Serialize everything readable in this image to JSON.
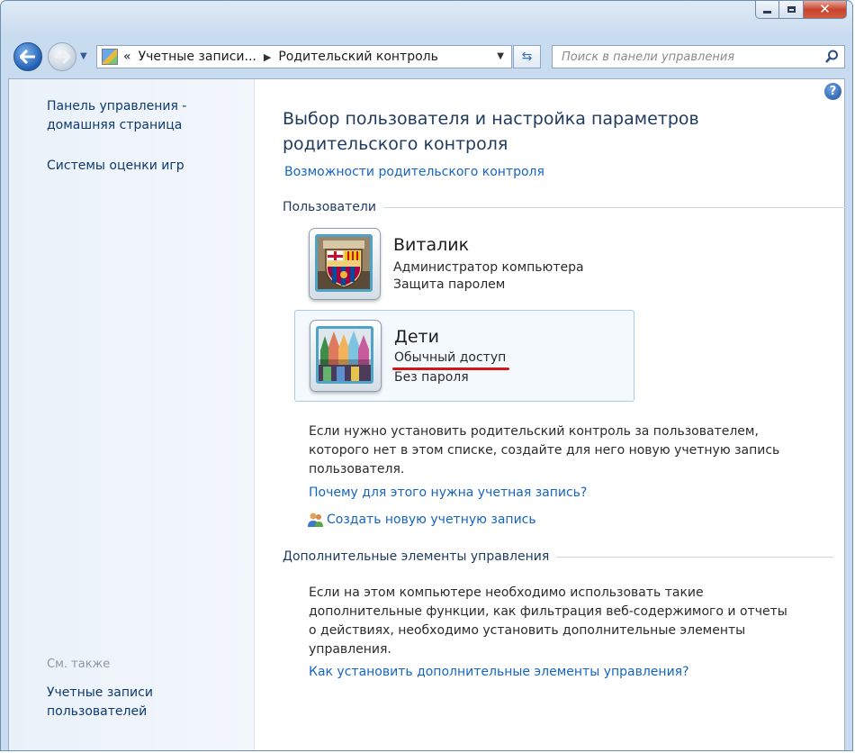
{
  "window": {
    "caption": {
      "minimize": "minimize",
      "maximize": "maximize",
      "close": "✕"
    }
  },
  "nav": {
    "breadcrumb": [
      "«",
      "Учетные записи...",
      "Родительский контроль"
    ],
    "search_placeholder": "Поиск в панели управления"
  },
  "sidebar": {
    "home_link": [
      "Панель управления -",
      "домашняя страница"
    ],
    "game_ratings": "Системы оценки игр",
    "see_also": "См. также",
    "user_accounts": [
      "Учетные записи",
      "пользователей"
    ]
  },
  "main": {
    "help": "?",
    "title": [
      "Выбор пользователя и настройка параметров",
      "родительского контроля"
    ],
    "features_link": "Возможности родительского контроля",
    "users_heading": "Пользователи",
    "users": [
      {
        "name": "Виталик",
        "type": "Администратор компьютера",
        "password": "Защита паролем"
      },
      {
        "name": "Дети",
        "type": "Обычный доступ",
        "password": "Без пароля"
      }
    ],
    "no_user_text": [
      "Если нужно установить родительский контроль за пользователем,",
      "которого нет в этом списке, создайте для него новую учетную запись",
      "пользователя."
    ],
    "why_link": "Почему для этого нужна учетная запись?",
    "create_link": "Создать новую учетную запись",
    "extra_heading": "Дополнительные элементы управления",
    "extra_text": [
      "Если на этом компьютере необходимо использовать такие",
      "дополнительные функции, как фильтрация веб-содержимого и отчеты",
      "о действиях, необходимо установить дополнительные элементы",
      "управления."
    ],
    "extra_link": "Как установить дополнительные элементы управления?"
  }
}
